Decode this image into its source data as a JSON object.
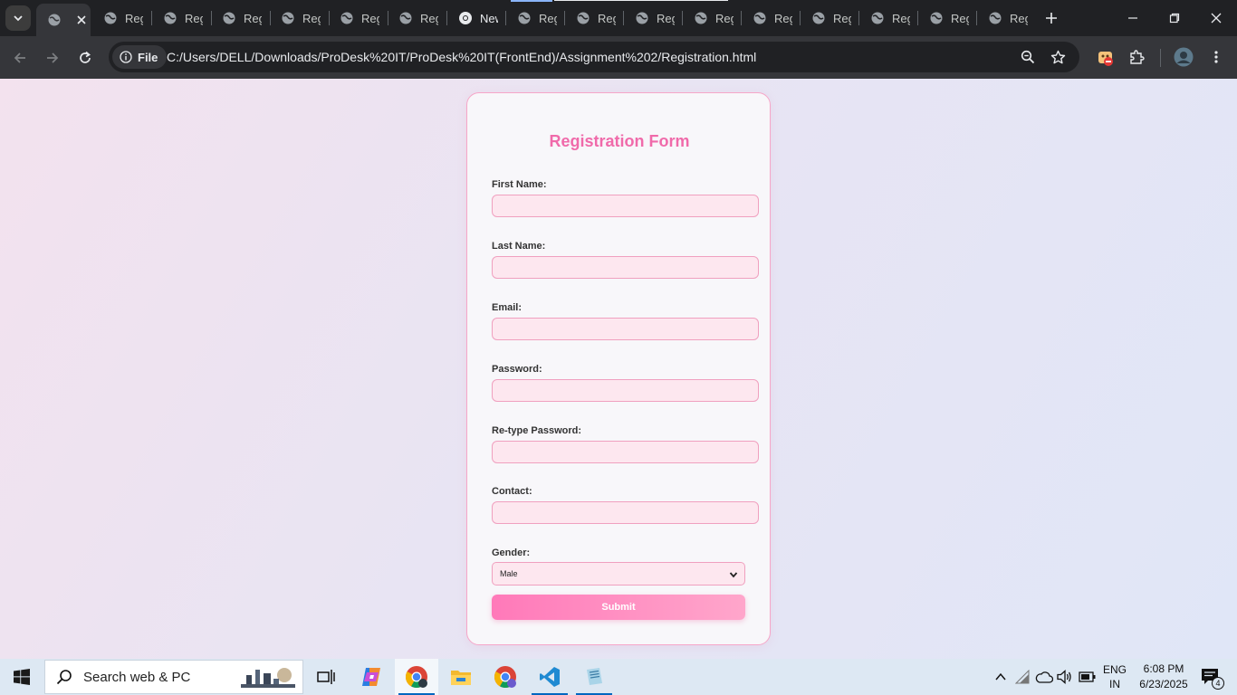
{
  "browser": {
    "tabs": [
      {
        "label": "",
        "favicon": "globe-icon",
        "active": true
      },
      {
        "label": "Reg",
        "favicon": "globe-icon"
      },
      {
        "label": "Reg",
        "favicon": "globe-icon"
      },
      {
        "label": "Reg",
        "favicon": "globe-icon"
      },
      {
        "label": "Reg",
        "favicon": "globe-icon"
      },
      {
        "label": "Reg",
        "favicon": "globe-icon"
      },
      {
        "label": "Reg",
        "favicon": "globe-icon"
      },
      {
        "label": "New",
        "favicon": "chrome-newtab-icon"
      },
      {
        "label": "Reg",
        "favicon": "globe-icon"
      },
      {
        "label": "Reg",
        "favicon": "globe-icon"
      },
      {
        "label": "Reg",
        "favicon": "globe-icon"
      },
      {
        "label": "Reg",
        "favicon": "globe-icon"
      },
      {
        "label": "Reg",
        "favicon": "globe-icon"
      },
      {
        "label": "Reg",
        "favicon": "globe-icon"
      },
      {
        "label": "Reg",
        "favicon": "globe-icon"
      },
      {
        "label": "Reg",
        "favicon": "globe-icon"
      },
      {
        "label": "Reg",
        "favicon": "globe-icon"
      }
    ],
    "site_chip": "File",
    "url": "C:/Users/DELL/Downloads/ProDesk%20IT/ProDesk%20IT(FrontEnd)/Assignment%202/Registration.html"
  },
  "form": {
    "title": "Registration Form",
    "fields": [
      {
        "label": "First Name:",
        "value": ""
      },
      {
        "label": "Last Name:",
        "value": ""
      },
      {
        "label": "Email:",
        "value": ""
      },
      {
        "label": "Password:",
        "value": ""
      },
      {
        "label": "Re-type Password:",
        "value": ""
      },
      {
        "label": "Contact:",
        "value": ""
      }
    ],
    "gender": {
      "label": "Gender:",
      "selected": "Male"
    },
    "submit_label": "Submit"
  },
  "taskbar": {
    "search_text": "Search web & PC",
    "language": "ENG",
    "region": "IN",
    "time": "6:08 PM",
    "date": "6/23/2025",
    "notification_count": "4"
  },
  "colors": {
    "accent_pink": "#f06aaa",
    "input_bg": "#fde7ef",
    "browser_dark": "#202124"
  }
}
